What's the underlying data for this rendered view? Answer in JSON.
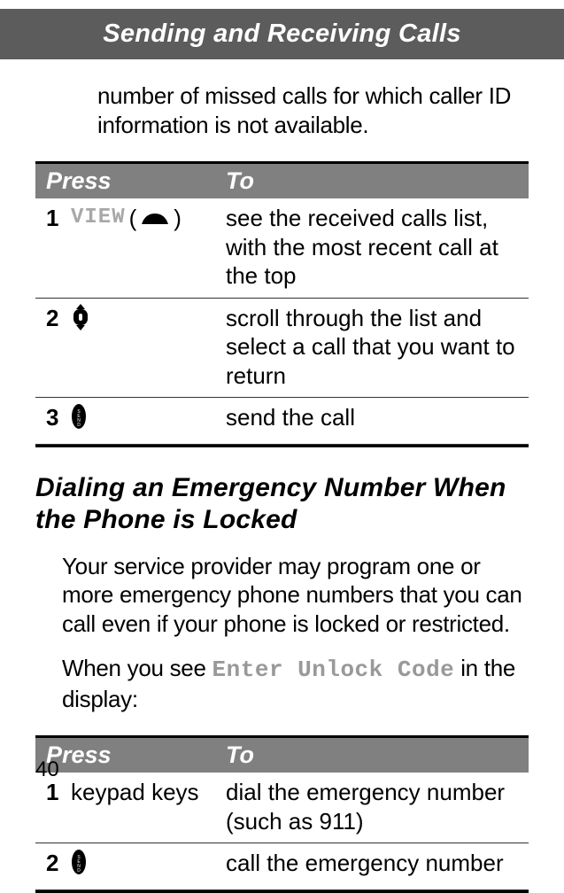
{
  "banner": "Sending and Receiving Calls",
  "continuation": "number of missed calls for which caller ID information is not available.",
  "table1": {
    "headers": {
      "press": "Press",
      "to": "To"
    },
    "rows": [
      {
        "num": "1",
        "keyLabel": "VIEW",
        "keySuffixOpen": "(",
        "keySuffixClose": ")",
        "iconType": "softkey",
        "to": "see the received calls list, with the most recent call at the top"
      },
      {
        "num": "2",
        "keyLabel": "",
        "iconType": "scroll",
        "to": "scroll through the list and select a call that you want to return"
      },
      {
        "num": "3",
        "keyLabel": "",
        "iconType": "send",
        "to": "send the call"
      }
    ]
  },
  "heading": "Dialing an Emergency Number When the Phone is Locked",
  "para1": "Your service provider may program one or more emergency phone numbers that you can call even if your phone is locked or restricted.",
  "para2_pre": "When you see ",
  "para2_code": "Enter Unlock Code",
  "para2_post": " in the display:",
  "table2": {
    "headers": {
      "press": "Press",
      "to": "To"
    },
    "rows": [
      {
        "num": "1",
        "keyText": "keypad keys",
        "iconType": "none",
        "to": "dial the emergency number (such as 911)"
      },
      {
        "num": "2",
        "keyText": "",
        "iconType": "send",
        "to": "call the emergency number"
      }
    ]
  },
  "pageNum": "40"
}
